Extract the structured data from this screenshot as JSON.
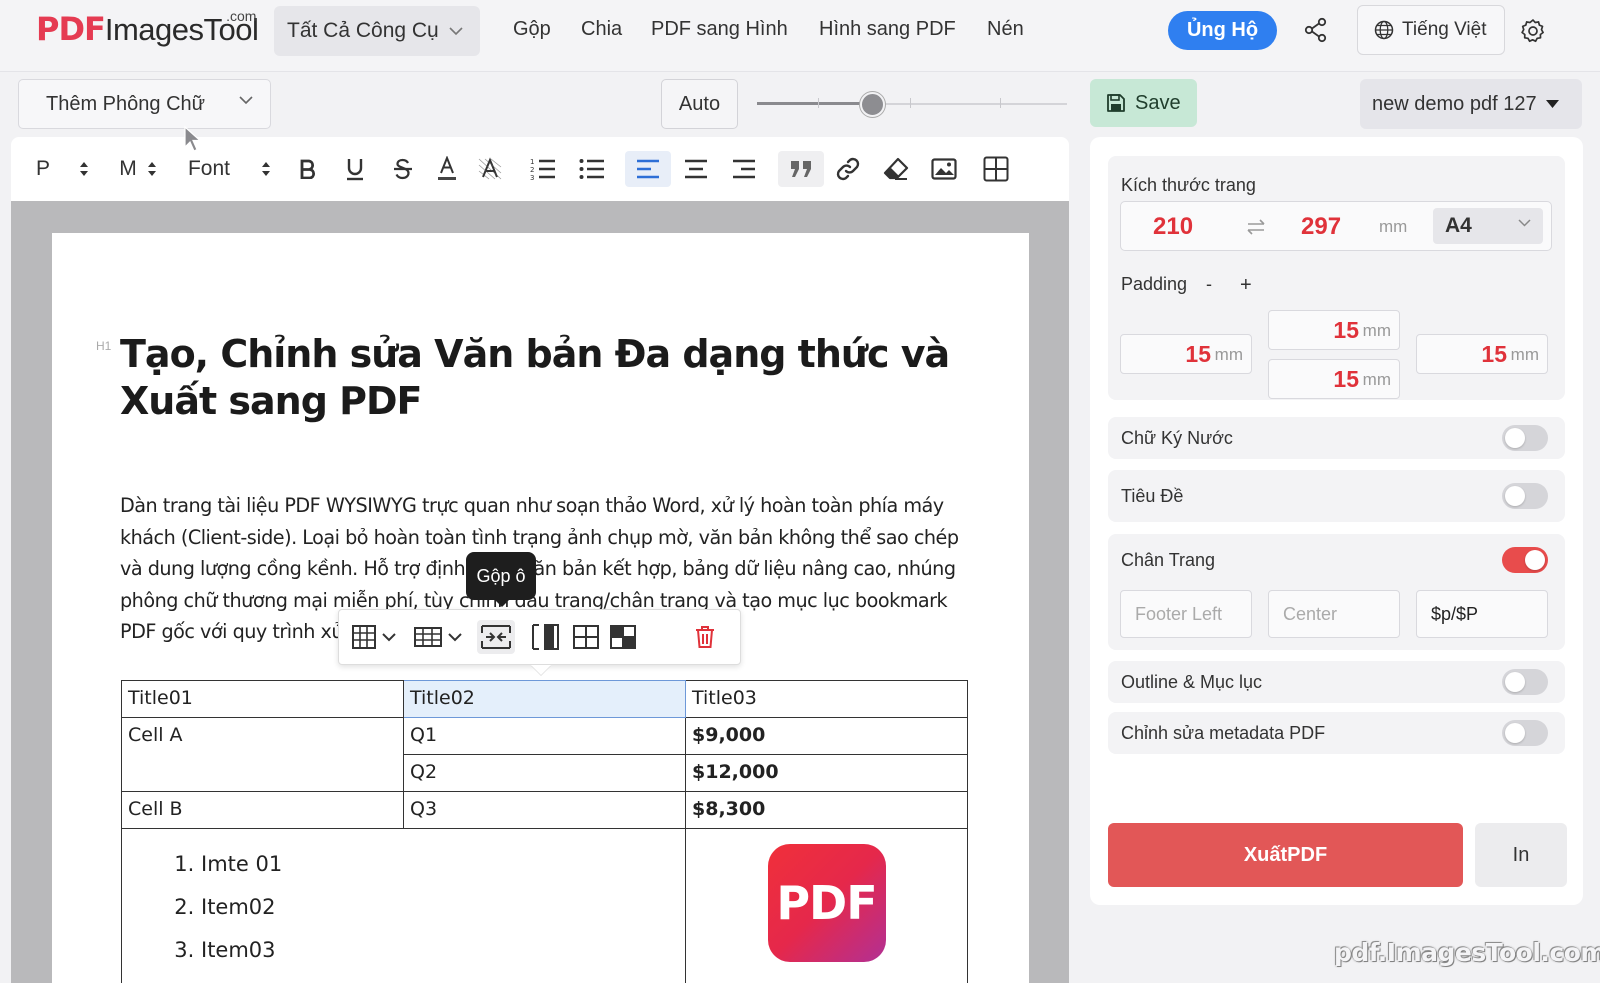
{
  "header": {
    "logo_pdf": "PDF",
    "logo_rest": "ImagesTool",
    "logo_com": ".com",
    "tools_dropdown": "Tất Cả Công Cụ",
    "nav": [
      "Gộp",
      "Chia",
      "PDF sang Hình",
      "Hình sang PDF",
      "Nén"
    ],
    "donate": "Ủng Hộ",
    "language": "Tiếng Việt"
  },
  "topbar": {
    "font_dropdown": "Thêm Phông Chữ",
    "auto": "Auto",
    "zoom_slider": 0.37,
    "save": "Save",
    "file_name": "new demo pdf 127"
  },
  "toolbar": {
    "paragraph": "P",
    "size": "M",
    "font": "Font"
  },
  "document": {
    "heading_tag": "H1",
    "title": "Tạo, Chỉnh sửa Văn bản Đa dạng thức và Xuất sang PDF",
    "paragraph": "Dàn trang tài liệu PDF WYSIWYG trực quan như soạn thảo Word, xử lý hoàn toàn phía máy khách (Client-side). Loại bỏ hoàn toàn tình trạng ảnh chụp mờ, văn bản không thể sao chép và dung lượng cồng kềnh. Hỗ trợ định dạng văn bản kết hợp, bảng dữ liệu nâng cao, nhúng phông chữ thương mại miễn phí, tùy chỉnh đầu trang/chân trang và tạo mục lục bookmark PDF gốc với quy trình xử lý",
    "tooltip": "Gộp ô",
    "table": {
      "headers": [
        "Title01",
        "Title02",
        "Title03"
      ],
      "cell_a": "Cell A",
      "cell_b": "Cell B",
      "rows": [
        {
          "q": "Q1",
          "v": "$9,000"
        },
        {
          "q": "Q2",
          "v": "$12,000"
        },
        {
          "q": "Q3",
          "v": "$8,300"
        }
      ],
      "list": [
        "Imte 01",
        "Item02",
        "Item03"
      ],
      "pdf_logo": "PDF"
    }
  },
  "panel": {
    "page_size_label": "Kích thước trang",
    "width": "210",
    "height": "297",
    "unit": "mm",
    "paper": "A4",
    "padding_label": "Padding",
    "padding_minus": "-",
    "padding_plus": "+",
    "padding": {
      "left": "15",
      "top": "15",
      "bottom": "15",
      "right": "15"
    },
    "watermark_label": "Chữ Ký Nước",
    "watermark_on": false,
    "header_label": "Tiêu Đề",
    "header_on": false,
    "footer_label": "Chân Trang",
    "footer_on": true,
    "footer_left_placeholder": "Footer Left",
    "footer_center_placeholder": "Center",
    "footer_right": "$p/$P",
    "outline_label": "Outline & Mục lục",
    "outline_on": false,
    "metadata_label": "Chỉnh sửa metadata PDF",
    "metadata_on": false,
    "export": "XuấtPDF",
    "print": "In"
  },
  "watermark_text": "pdf.ImagesTool.com",
  "colors": {
    "accent_red": "#e25757",
    "brand_red": "#e53b52",
    "donate_blue": "#2f7ff0",
    "save_green": "#c7e8d6"
  }
}
